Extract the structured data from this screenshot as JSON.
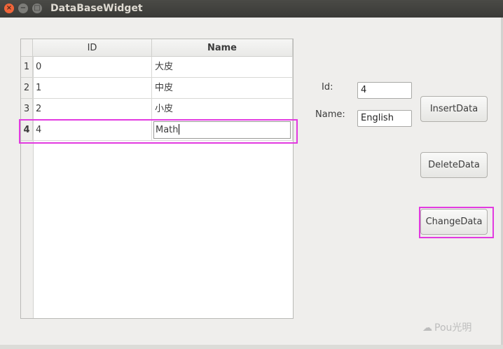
{
  "window": {
    "title": "DataBaseWidget"
  },
  "table": {
    "columns": [
      "ID",
      "Name"
    ],
    "rows": [
      {
        "num": "1",
        "id": "0",
        "name": "大皮"
      },
      {
        "num": "2",
        "id": "1",
        "name": "中皮"
      },
      {
        "num": "3",
        "id": "2",
        "name": "小皮"
      },
      {
        "num": "4",
        "id": "4",
        "name": "Math"
      }
    ]
  },
  "form": {
    "id_label": "Id:",
    "id_value": "4",
    "name_label": "Name:",
    "name_value": "English"
  },
  "buttons": {
    "insert": "InsertData",
    "delete": "DeleteData",
    "change": "ChangeData"
  },
  "watermark": {
    "icon": "wechat-icon",
    "text": "Pou光明"
  },
  "colors": {
    "highlight": "#e23ae0",
    "titlebar": "#3c3b37",
    "close": "#f0653a"
  }
}
